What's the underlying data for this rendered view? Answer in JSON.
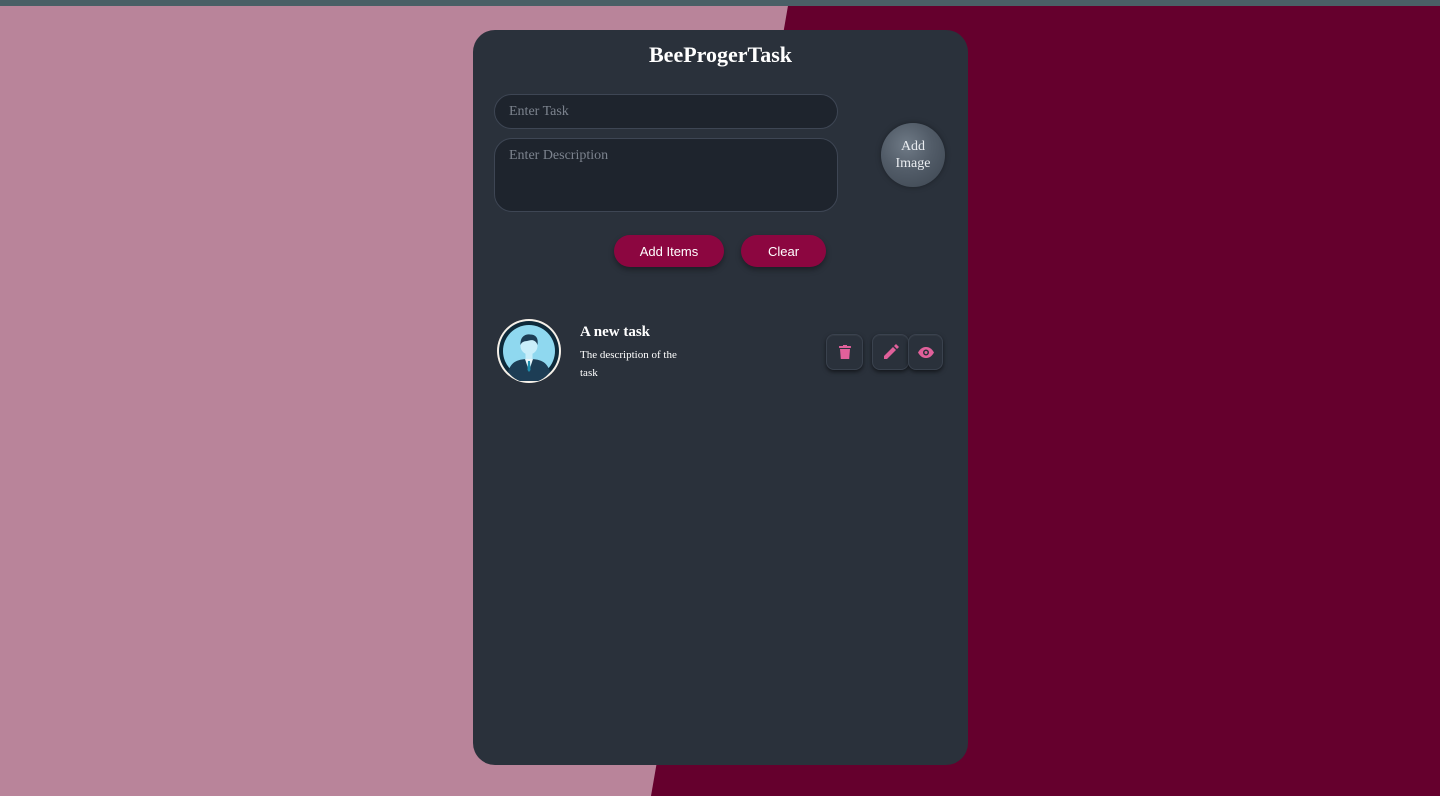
{
  "app": {
    "title": "BeeProgerTask"
  },
  "form": {
    "task_placeholder": "Enter Task",
    "description_placeholder": "Enter Description",
    "add_image_label": "Add Image",
    "add_items_label": "Add Items",
    "clear_label": "Clear"
  },
  "tasks": [
    {
      "title": "A new task",
      "description": "The description of the task",
      "actions": {
        "delete": "trash-icon",
        "edit": "pencil-icon",
        "view": "eye-icon"
      }
    }
  ],
  "colors": {
    "background_left": "#b9849a",
    "background_right": "#65002d",
    "card": "#2a313b",
    "button": "#8c0640",
    "action_icon": "#e0609a"
  }
}
